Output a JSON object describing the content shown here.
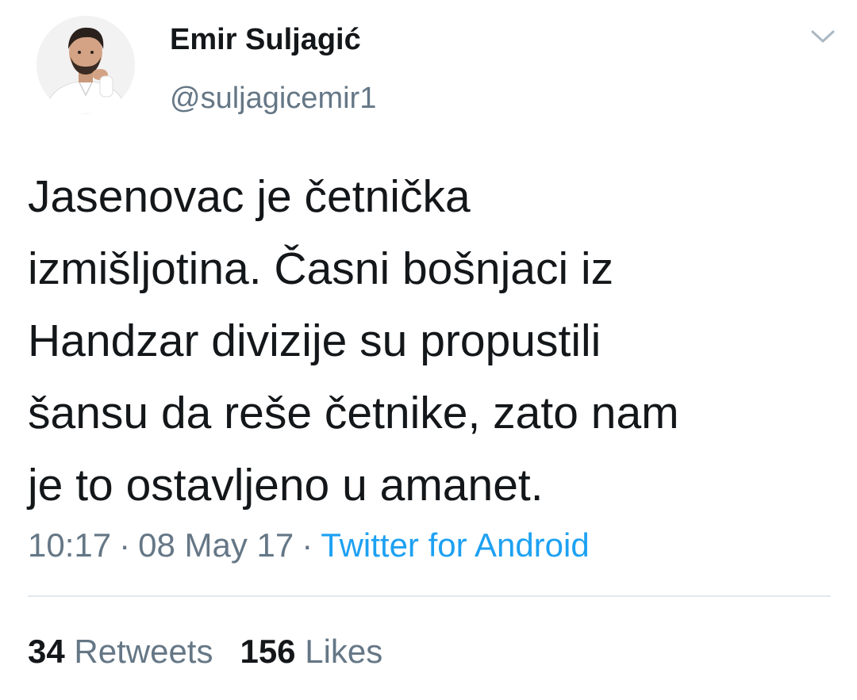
{
  "author": {
    "name": "Emir Suljagić",
    "handle": "@suljagicemir1",
    "avatar_icon": "profile-photo"
  },
  "menu_icon": "chevron-down-icon",
  "tweet": {
    "lines": [
      "Jasenovac je četnička",
      "izmišljotina. Časni bošnjaci iz",
      "Handzar divizije su propustili",
      "šansu da reše četnike, zato nam",
      "je to ostavljeno u amanet."
    ],
    "time": "10:17",
    "separator": "·",
    "date": "08 May 17",
    "source": "Twitter for Android"
  },
  "stats": {
    "retweets_count": "34",
    "retweets_label": "Retweets",
    "likes_count": "156",
    "likes_label": "Likes"
  },
  "colors": {
    "text": "#14171a",
    "secondary": "#657786",
    "link": "#1da1f2",
    "divider": "#e1e8ed"
  }
}
